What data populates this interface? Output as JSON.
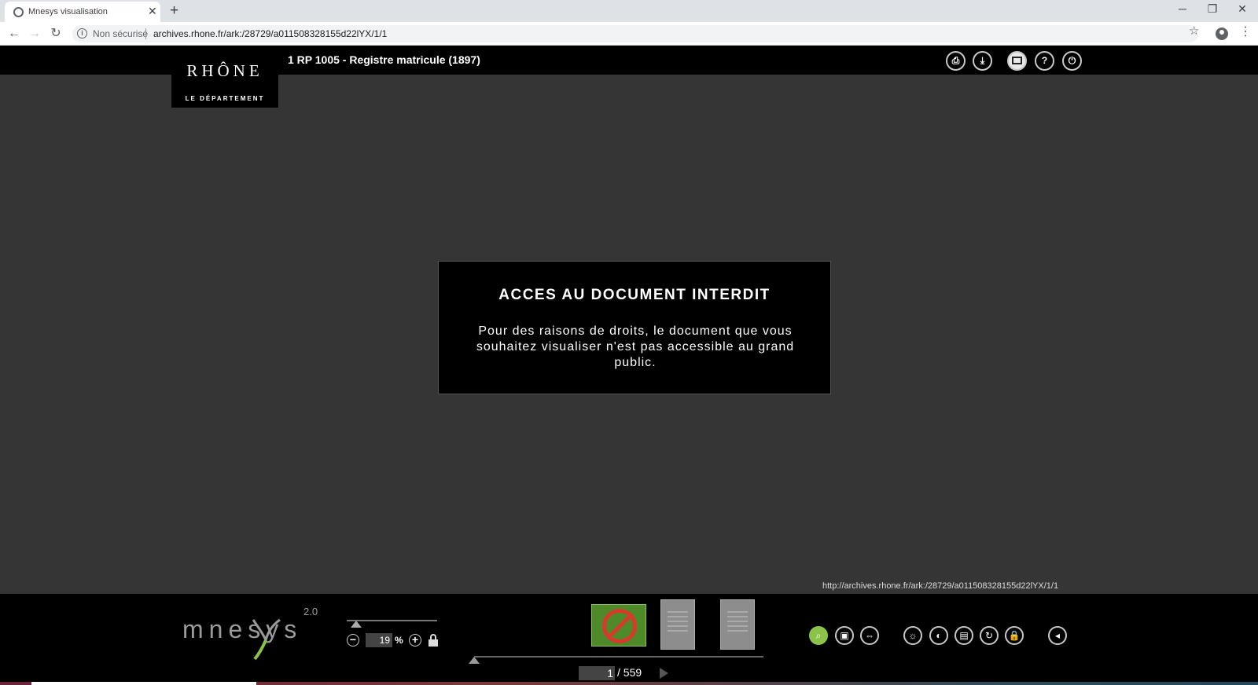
{
  "browser": {
    "tab_title": "Mnesys visualisation",
    "tab_close": "✕",
    "new_tab": "+",
    "security_label": "Non sécurisé",
    "url": "archives.rhone.fr/ark:/28729/a011508328155d22lYX/1/1",
    "window_controls": {
      "minimize": "─",
      "restore": "❐",
      "close": "✕"
    }
  },
  "viewer": {
    "logo_main": "RHÔNE",
    "logo_sub": "LE DÉPARTEMENT",
    "doc_title": "1 RP 1005 - Registre matricule (1897)",
    "header_icons": [
      "print-icon",
      "download-icon",
      "fullscreen-icon",
      "help-icon",
      "power-icon"
    ]
  },
  "message": {
    "title": "ACCES AU DOCUMENT INTERDIT",
    "body": "Pour des raisons de droits, le document que vous souhaitez visualiser n'est pas accessible au grand public."
  },
  "status_url": "http://archives.rhone.fr/ark:/28729/a011508328155d22lYX/1/1",
  "footer": {
    "brand": "mnesys",
    "version": "2.0",
    "zoom_value": "19",
    "zoom_unit": "%",
    "page_current": "1",
    "page_total": "/ 559",
    "colors": {
      "active_icon": "#8bc34a",
      "forbidden": "#d63a2a"
    }
  }
}
